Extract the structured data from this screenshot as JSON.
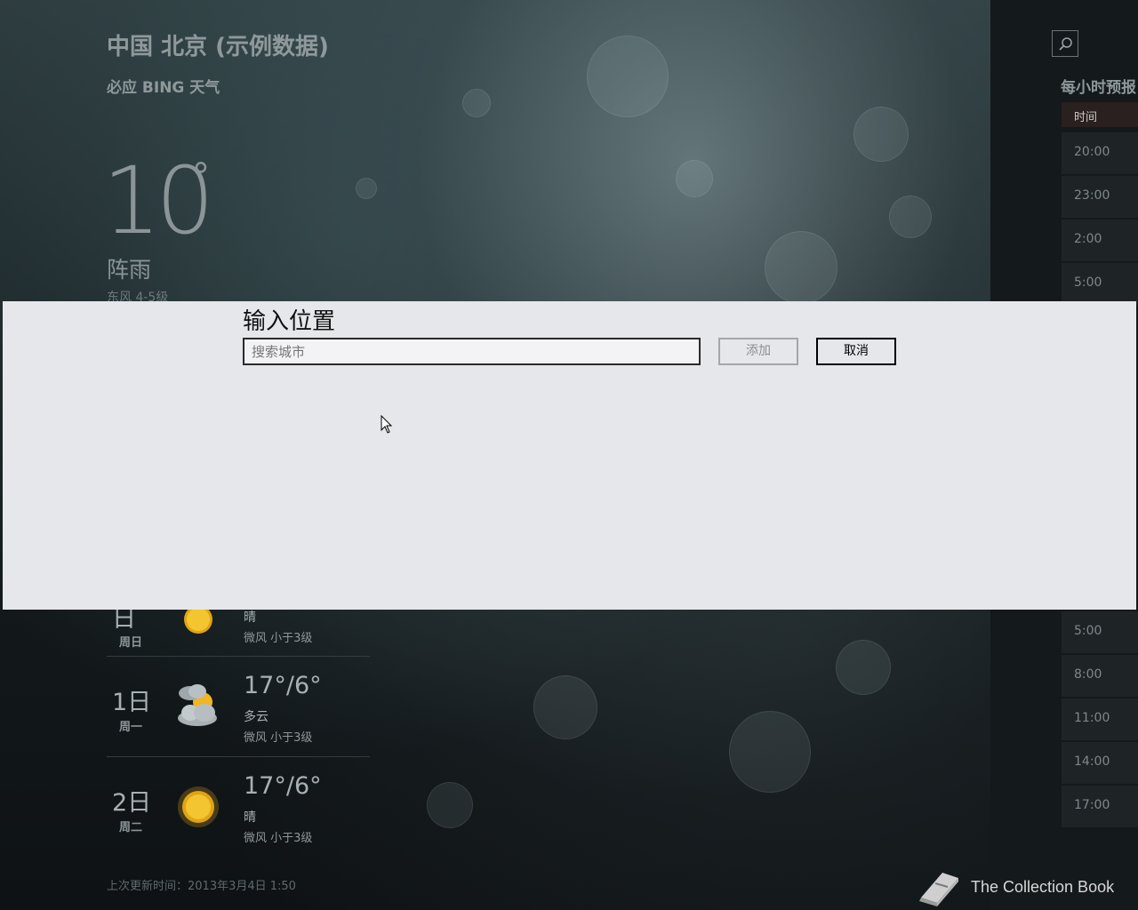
{
  "current": {
    "city": "中国 北京 (示例数据)",
    "provider": "必应 BING 天气",
    "temperature": "10",
    "degree_symbol": "°",
    "condition": "阵雨",
    "wind": "东风 4-5级"
  },
  "forecast": [
    {
      "day": "日",
      "weekday": "周日",
      "temp": "",
      "condition": "晴",
      "wind": "微风 小于3级",
      "icon": "sun-icon"
    },
    {
      "day": "1日",
      "weekday": "周一",
      "temp": "17°/6°",
      "condition": "多云",
      "wind": "微风 小于3级",
      "icon": "cloudy-icon"
    },
    {
      "day": "2日",
      "weekday": "周二",
      "temp": "17°/6°",
      "condition": "晴",
      "wind": "微风 小于3级",
      "icon": "sun-icon"
    }
  ],
  "last_update": "上次更新时间：2013年3月4日 1:50",
  "hourly": {
    "title": "每小时预报",
    "header": "时间",
    "times_top": [
      "20:00",
      "23:00",
      "2:00",
      "5:00"
    ],
    "times_bottom": [
      "5:00",
      "8:00",
      "11:00",
      "14:00",
      "17:00"
    ]
  },
  "dialog": {
    "title": "输入位置",
    "search_placeholder": "搜索城市",
    "search_value": "",
    "add_label": "添加",
    "cancel_label": "取消"
  },
  "watermark": {
    "text": "The Collection Book",
    "icon": "book-icon"
  },
  "colors": {
    "dialog_bg": "#e6e7eb",
    "panel_bg": "#14191b"
  }
}
